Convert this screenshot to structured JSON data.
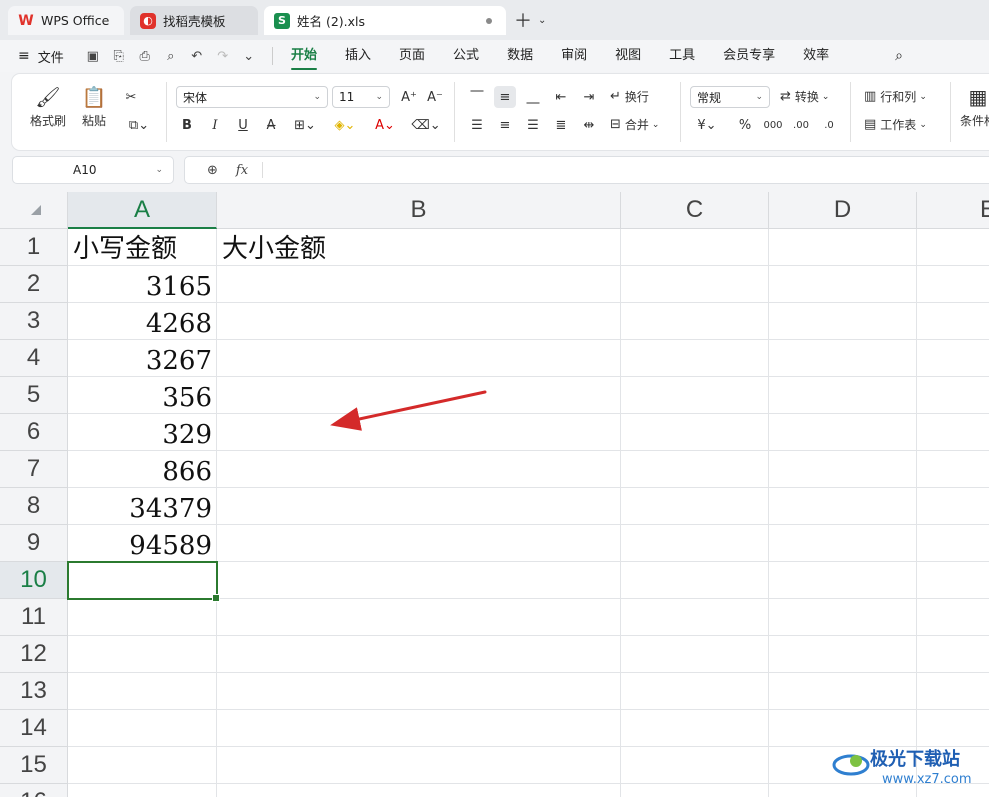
{
  "tabs": {
    "wps": "WPS Office",
    "templates": "找稻壳模板",
    "document": "姓名 (2).xls",
    "doc_icon_letter": "S"
  },
  "menu": {
    "file": "文件",
    "items": [
      "开始",
      "插入",
      "页面",
      "公式",
      "数据",
      "审阅",
      "视图",
      "工具",
      "会员专享",
      "效率"
    ],
    "active": "开始"
  },
  "ribbon": {
    "format_painter": "格式刷",
    "paste": "粘贴",
    "font_name": "宋体",
    "font_size": "11",
    "wrap": "换行",
    "merge": "合并",
    "number_format": "常规",
    "convert": "转换",
    "row_col": "行和列",
    "worksheet": "工作表",
    "conditional": "条件格"
  },
  "formula_bar": {
    "name_box": "A10",
    "fx": "fx",
    "value": ""
  },
  "sheet": {
    "columns": [
      "A",
      "B",
      "C",
      "D",
      "E"
    ],
    "rows": [
      "1",
      "2",
      "3",
      "4",
      "5",
      "6",
      "7",
      "8",
      "9",
      "10",
      "11",
      "12",
      "13",
      "14",
      "15",
      "16"
    ],
    "selected_column": "A",
    "selected_row": "10",
    "cells": {
      "A1": "小写金额",
      "B1": "大小金额",
      "A2": "3165",
      "A3": "4268",
      "A4": "3267",
      "A5": "356",
      "A6": "329",
      "A7": "866",
      "A8": "34379",
      "A9": "94589"
    }
  },
  "annotation": {
    "arrow_color": "#d42a2a"
  },
  "watermark": {
    "title": "极光下载站",
    "url": "www.xz7.com"
  },
  "colors": {
    "accent": "#1a7f46",
    "selection_border": "#2b7a2f"
  }
}
